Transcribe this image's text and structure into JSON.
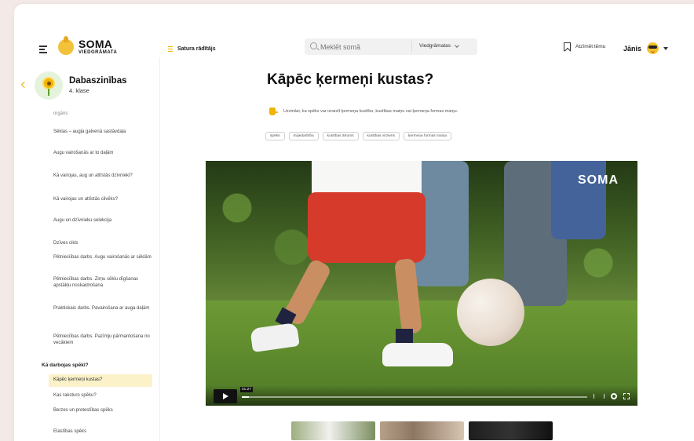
{
  "header": {
    "logo_title": "SOMA",
    "logo_subtitle": "VIEDGRĀMATA",
    "toc_label": "Satura rādītājs",
    "search_placeholder": "Meklēt somā",
    "search_scope": "Viedgrāmatas",
    "bookmark_label": "Atzīmēt tēmu",
    "user_name": "Jānis"
  },
  "sidebar": {
    "subject_title": "Dabaszinības",
    "subject_grade": "4. klase",
    "items": [
      {
        "label": "orgāns",
        "type": "cut"
      },
      {
        "label": "Sēklas – augļa galvenā sastāvdaļa",
        "type": "item"
      },
      {
        "label": "Augu vairošanās ar to daļām",
        "type": "item"
      },
      {
        "label": "Kā vairojas, aug un attīstās dzīvnieki?",
        "type": "item"
      },
      {
        "label": "Kā vairojas un attīstās cilvēks?",
        "type": "item"
      },
      {
        "label": "Augu un dzīvnieku selekcija",
        "type": "item"
      },
      {
        "label": "Dzīves cikls",
        "type": "item"
      },
      {
        "label": "Pētnieciības darbs. Augu vairošanās ar sēklām",
        "type": "item"
      },
      {
        "label": "Pētnieciības darbs. Zirņu sēklu dīgšanas apstākļu noskaidrošana",
        "type": "item"
      },
      {
        "label": "Praktiskais darbs. Pavairošana ar auga daļām",
        "type": "item"
      },
      {
        "label": "Pētnieciības darbs. Pazīmju pārmantošana no vecākiem",
        "type": "item"
      },
      {
        "label": "Kā darbojas spēki?",
        "type": "section"
      },
      {
        "label": "Kāpēc ķermeņi kustas?",
        "type": "active"
      },
      {
        "label": "Kas raksturo spēku?",
        "type": "item"
      },
      {
        "label": "Berzes un pretestības spēks",
        "type": "item"
      },
      {
        "label": "Elastības spēks",
        "type": "item"
      }
    ]
  },
  "main": {
    "title": "Kāpēc ķermeņi kustas?",
    "goal": "Uzzināsi, ka spēks var izraisīt ķermeņa kustību, kustības maiņu vai ķermeņa formas maiņu.",
    "tags": [
      "spēks",
      "mijiedarbība",
      "kustības ātrums",
      "kustības virziens",
      "ķermeņa formas maiņa"
    ]
  },
  "video": {
    "watermark": "SOMA",
    "time": "01:27",
    "progress": 0.02
  },
  "colors": {
    "accent": "#f0b400",
    "active_bg": "#fbf2c9",
    "background": "#f3e9e6"
  }
}
